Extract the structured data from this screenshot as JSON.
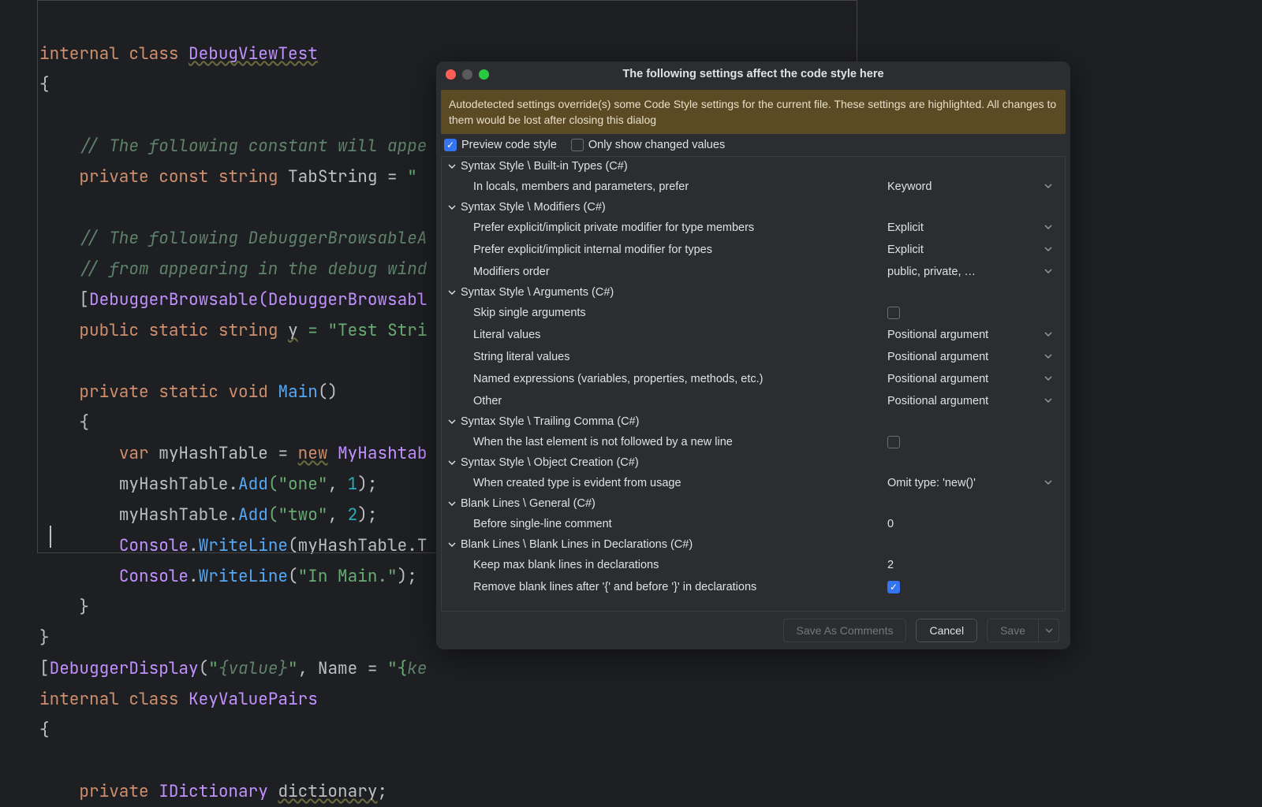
{
  "editor": {
    "code_tokens": "rendered directly in template (visual only)",
    "class1_keyword_internal": "internal",
    "class1_keyword_class": "class",
    "class1_name": "DebugViewTest",
    "comment1": "// The following constant will appe",
    "const_kw_private": "private",
    "const_kw_const": "const",
    "const_kw_string": "string",
    "const_name": "TabString",
    "const_eq": " = ",
    "const_val": "\"",
    "comment2": "// The following DebuggerBrowsableA",
    "comment3": "// from appearing in the debug wind",
    "attr_open": "[",
    "attr_name": "DebuggerBrowsable",
    "attr_arg": "(DebuggerBrowsabl",
    "y_kw_public": "public",
    "y_kw_static": "static",
    "y_kw_string": "string",
    "y_name": "y",
    "y_val": " = \"Test Stri",
    "main_kw_private": "private",
    "main_kw_static": "static",
    "main_kw_void": "void",
    "main_name": "Main",
    "var_kw": "var",
    "ht_name": "myHashTable",
    "new_kw": "new",
    "ht_type": "MyHashtab",
    "add1_args": "(\"one\", 1);",
    "add2_args": "(\"two\", 2);",
    "console": "Console",
    "writeln": "WriteLine",
    "wl1_suffix": "(myHashTable.T",
    "wl2_args": "(\"In Main.\");",
    "attr2": "DebuggerDisplay",
    "attr2_args_a": "(\"",
    "attr2_fmt1": "{value}",
    "attr2_args_b": "\", ",
    "attr2_name_kw": "Name",
    "attr2_args_c": " = \"{ke",
    "class2_name": "KeyValuePairs",
    "dict_kw": "private",
    "dict_type": "IDictionary",
    "dict_name": "dictionary"
  },
  "dialog": {
    "title": "The following settings affect the code style here",
    "banner": "Autodetected settings override(s) some Code Style settings for the current file. These settings are highlighted. All changes to them would be lost after closing this dialog",
    "preview_label": "Preview code style",
    "only_changed_label": "Only show changed values",
    "groups": [
      {
        "title": "Syntax Style \\ Built-in Types (C#)",
        "rows": [
          {
            "label": "In locals, members and parameters, prefer",
            "type": "select",
            "value": "Keyword"
          }
        ]
      },
      {
        "title": "Syntax Style \\ Modifiers (C#)",
        "rows": [
          {
            "label": "Prefer explicit/implicit private modifier for type members",
            "type": "select",
            "value": "Explicit"
          },
          {
            "label": "Prefer explicit/implicit internal modifier for types",
            "type": "select",
            "value": "Explicit"
          },
          {
            "label": "Modifiers order",
            "type": "select",
            "value": "public, private, …"
          }
        ]
      },
      {
        "title": "Syntax Style \\ Arguments (C#)",
        "rows": [
          {
            "label": "Skip single arguments",
            "type": "checkbox",
            "value": false
          },
          {
            "label": "Literal values",
            "type": "select",
            "value": "Positional argument"
          },
          {
            "label": "String literal values",
            "type": "select",
            "value": "Positional argument"
          },
          {
            "label": "Named expressions (variables, properties, methods, etc.)",
            "type": "select",
            "value": "Positional argument"
          },
          {
            "label": "Other",
            "type": "select",
            "value": "Positional argument"
          }
        ]
      },
      {
        "title": "Syntax Style \\ Trailing Comma (C#)",
        "rows": [
          {
            "label": "When the last element is not followed by a new line",
            "type": "checkbox",
            "value": false
          }
        ]
      },
      {
        "title": "Syntax Style \\ Object Creation (C#)",
        "rows": [
          {
            "label": "When created type is evident from usage",
            "type": "select",
            "value": "Omit type: 'new()'"
          }
        ]
      },
      {
        "title": "Blank Lines \\ General (C#)",
        "rows": [
          {
            "label": "Before single-line comment",
            "type": "text",
            "value": "0"
          }
        ]
      },
      {
        "title": "Blank Lines \\ Blank Lines in Declarations (C#)",
        "rows": [
          {
            "label": "Keep max blank lines in declarations",
            "type": "text",
            "value": "2"
          },
          {
            "label": "Remove blank lines after '{' and before '}' in declarations",
            "type": "checkbox",
            "value": true
          }
        ]
      }
    ],
    "buttons": {
      "save_as_comments": "Save As Comments",
      "cancel": "Cancel",
      "save": "Save"
    }
  }
}
